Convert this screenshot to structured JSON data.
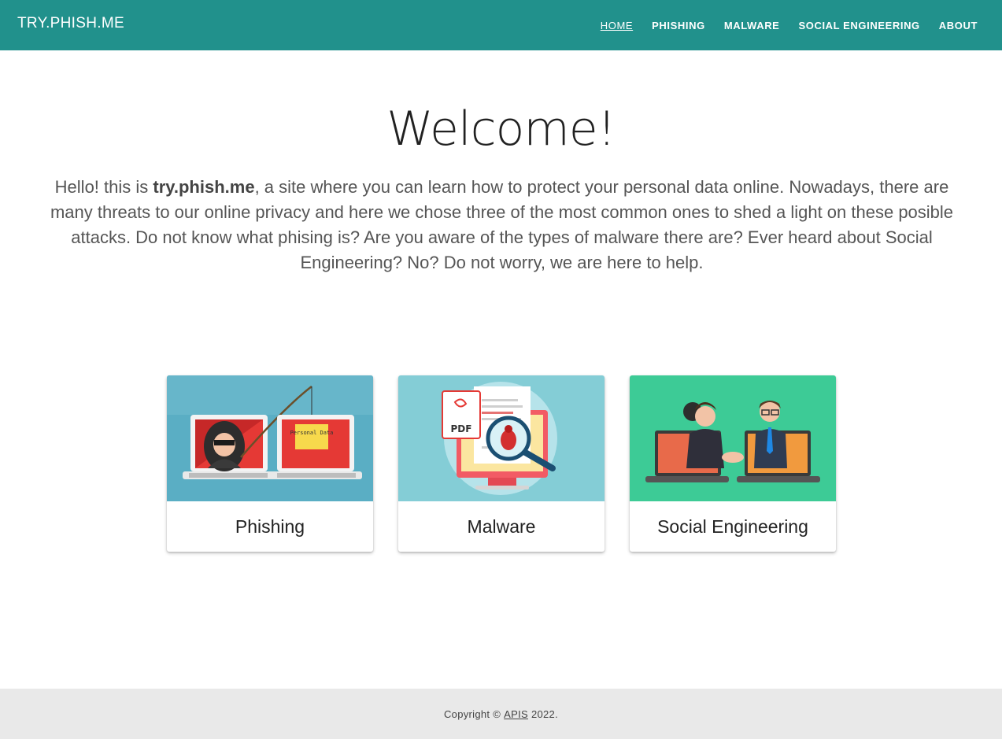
{
  "brand": "TRY.PHISH.ME",
  "nav": [
    {
      "label": "HOME",
      "active": true
    },
    {
      "label": "PHISHING",
      "active": false
    },
    {
      "label": "MALWARE",
      "active": false
    },
    {
      "label": "SOCIAL ENGINEERING",
      "active": false
    },
    {
      "label": "ABOUT",
      "active": false
    }
  ],
  "hero": {
    "title": "Welcome!",
    "intro_prefix": "Hello! this is ",
    "intro_bold": "try.phish.me",
    "intro_suffix": ", a site where you can learn how to protect your personal data online. Nowadays, there are many threats to our online privacy and here we chose three of the most common ones to shed a light on these posible attacks. Do not know what phising is? Are you aware of the types of malware there are? Ever heard about Social Engineering? No? Do not worry, we are here to help."
  },
  "cards": [
    {
      "title": "Phishing",
      "image_icon": "phishing-hacker-laptops-illustration",
      "image_text": "Personal Data",
      "bg": "#5aaec4"
    },
    {
      "title": "Malware",
      "image_icon": "malware-pdf-magnifier-illustration",
      "image_text": "PDF",
      "bg": "#84cdd6"
    },
    {
      "title": "Social Engineering",
      "image_icon": "social-engineering-handshake-illustration",
      "bg": "#3dcb96"
    }
  ],
  "footer": {
    "prefix": "Copyright ©",
    "link": "APIS",
    "suffix": "2022."
  },
  "colors": {
    "header": "#21918c",
    "footer": "#e9e9e9"
  }
}
